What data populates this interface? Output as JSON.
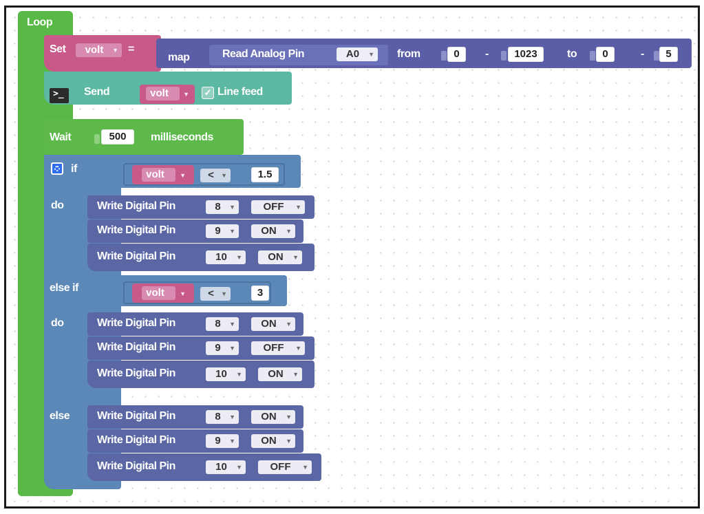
{
  "loop": {
    "label": "Loop"
  },
  "set_block": {
    "set_label": "Set",
    "variable": "volt",
    "equals": "=",
    "map_label": "map",
    "read_label": "Read Analog Pin",
    "pin": "A0",
    "from_label": "from",
    "from_low": "0",
    "dash1": "-",
    "from_high": "1023",
    "to_label": "to",
    "to_low": "0",
    "dash2": "-",
    "to_high": "5"
  },
  "send_block": {
    "send_label": "Send",
    "variable": "volt",
    "line_feed_label": "Line feed",
    "check_mark": "✓"
  },
  "wait_block": {
    "wait_label": "Wait",
    "value": "500",
    "unit": "milliseconds"
  },
  "if_block": {
    "if_label": "if",
    "do_label": "do",
    "else_if_label": "else if",
    "else_label": "else",
    "cond1": {
      "variable": "volt",
      "op": "<",
      "value": "1.5"
    },
    "cond2": {
      "variable": "volt",
      "op": "<",
      "value": "3"
    }
  },
  "write_label": "Write Digital Pin",
  "branch1": [
    {
      "pin": "8",
      "state": "OFF"
    },
    {
      "pin": "9",
      "state": "ON"
    },
    {
      "pin": "10",
      "state": "ON"
    }
  ],
  "branch2": [
    {
      "pin": "8",
      "state": "ON"
    },
    {
      "pin": "9",
      "state": "OFF"
    },
    {
      "pin": "10",
      "state": "ON"
    }
  ],
  "branch3": [
    {
      "pin": "8",
      "state": "ON"
    },
    {
      "pin": "9",
      "state": "ON"
    },
    {
      "pin": "10",
      "state": "OFF"
    }
  ],
  "colors": {
    "loop_green": "#58b947",
    "set_pink": "#c85a8a",
    "math_purple": "#5b5ea6",
    "text_teal": "#5cb8a0",
    "wait_green": "#5cb94a",
    "if_blue": "#5b88b6",
    "io_purple": "#5b67a5",
    "var_pink": "#c85a8a"
  }
}
